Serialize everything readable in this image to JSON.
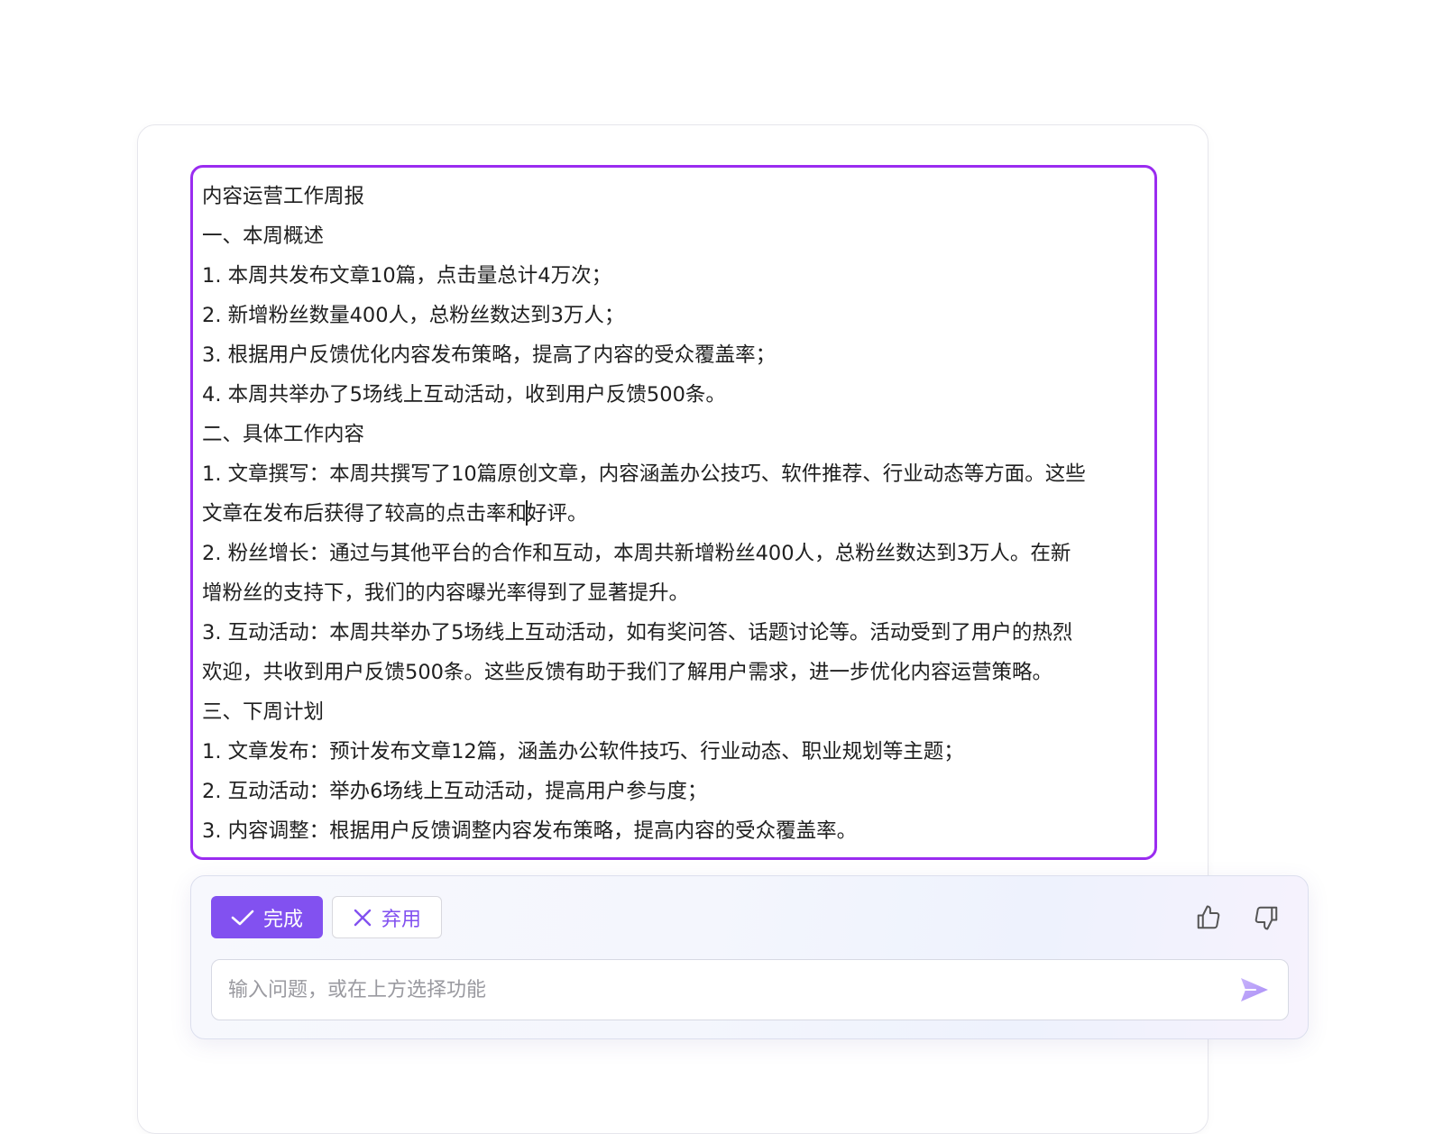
{
  "document": {
    "lines": [
      "内容运营工作周报",
      "一、本周概述",
      "1. 本周共发布文章10篇，点击量总计4万次；",
      "2. 新增粉丝数量400人，总粉丝数达到3万人；",
      "3. 根据用户反馈优化内容发布策略，提高了内容的受众覆盖率；",
      "4. 本周共举办了5场线上互动活动，收到用户反馈500条。",
      "二、具体工作内容",
      "1. 文章撰写：本周共撰写了10篇原创文章，内容涵盖办公技巧、软件推荐、行业动态等方面。这些",
      "",
      "2. 粉丝增长：通过与其他平台的合作和互动，本周共新增粉丝400人，总粉丝数达到3万人。在新",
      "增粉丝的支持下，我们的内容曝光率得到了显著提升。",
      "3. 互动活动：本周共举办了5场线上互动活动，如有奖问答、话题讨论等。活动受到了用户的热烈",
      "欢迎，共收到用户反馈500条。这些反馈有助于我们了解用户需求，进一步优化内容运营策略。",
      "三、下周计划",
      "1. 文章发布：预计发布文章12篇，涵盖办公软件技巧、行业动态、职业规划等主题；",
      "2. 互动活动：举办6场线上互动活动，提高用户参与度；",
      "3. 内容调整：根据用户反馈调整内容发布策略，提高内容的受众覆盖率。"
    ],
    "caret_line": {
      "before": "文章在发布后获得了较高的点击率和",
      "after": "好评。"
    }
  },
  "panel": {
    "done_label": "完成",
    "discard_label": "弃用",
    "input_placeholder": "输入问题，或在上方选择功能"
  },
  "colors": {
    "accent": "#8251f0",
    "selection_border": "#9a2cf0"
  },
  "icons": [
    "check-icon",
    "close-icon",
    "thumbs-up-icon",
    "thumbs-down-icon",
    "send-icon"
  ]
}
